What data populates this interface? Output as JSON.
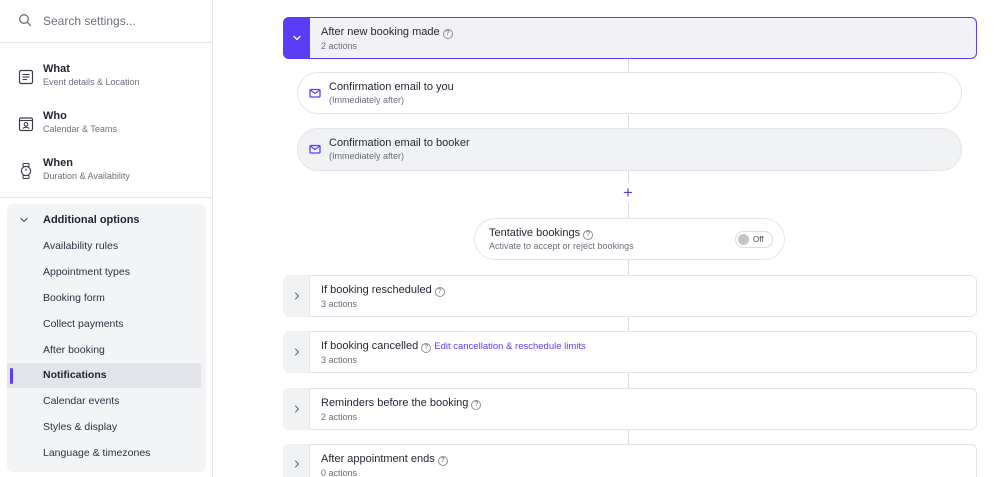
{
  "sidebar": {
    "search": {
      "placeholder": "Search settings..."
    },
    "main_items": [
      {
        "title": "What",
        "subtitle": "Event details & Location",
        "icon": "document-icon"
      },
      {
        "title": "Who",
        "subtitle": "Calendar & Teams",
        "icon": "contact-card-icon"
      },
      {
        "title": "When",
        "subtitle": "Duration & Availability",
        "icon": "watch-icon"
      }
    ],
    "additional": {
      "label": "Additional options",
      "items": [
        "Availability rules",
        "Appointment types",
        "Booking form",
        "Collect payments",
        "After booking",
        "Notifications",
        "Calendar events",
        "Styles & display",
        "Language & timezones"
      ],
      "active_index": 5
    }
  },
  "main": {
    "new_booking": {
      "title": "After new booking made",
      "subtitle": "2 actions"
    },
    "actions": [
      {
        "title": "Confirmation email to you",
        "subtitle": "(Immediately after)",
        "icon": "mail-icon"
      },
      {
        "title": "Confirmation email to booker",
        "subtitle": "(Immediately after)",
        "icon": "mail-icon"
      }
    ],
    "add_symbol": "+",
    "tentative": {
      "title": "Tentative bookings",
      "subtitle": "Activate to accept or reject bookings",
      "toggle_label": "Off",
      "enabled": false
    },
    "sections": [
      {
        "title": "If booking rescheduled",
        "subtitle": "3 actions"
      },
      {
        "title": "If booking cancelled",
        "subtitle": "3 actions",
        "link": "Edit cancellation & reschedule limits"
      },
      {
        "title": "Reminders before the booking",
        "subtitle": "2 actions"
      },
      {
        "title": "After appointment ends",
        "subtitle": "0 actions"
      }
    ],
    "help_symbol": "?"
  },
  "colors": {
    "accent": "#5b3df5",
    "border": "#e4e5ea",
    "muted": "#6b6f7b"
  }
}
